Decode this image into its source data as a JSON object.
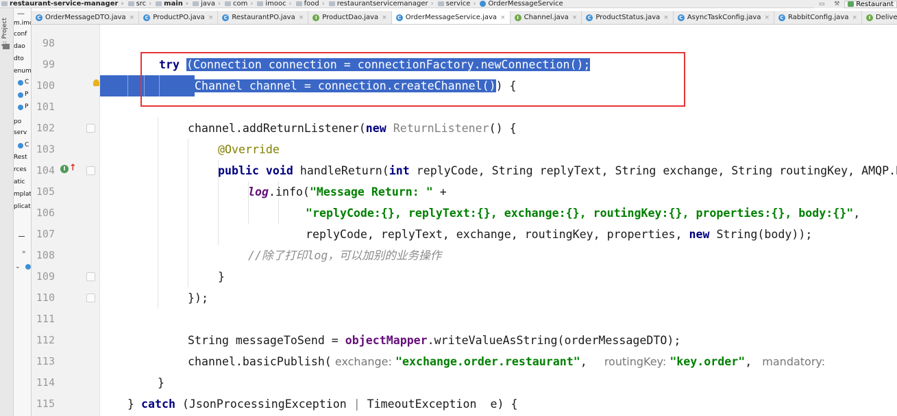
{
  "breadcrumb": [
    {
      "label": "restaurant-service-manager",
      "kind": "module"
    },
    {
      "label": "src",
      "kind": "folder"
    },
    {
      "label": "main",
      "kind": "folder-bold"
    },
    {
      "label": "java",
      "kind": "folder"
    },
    {
      "label": "com",
      "kind": "folder"
    },
    {
      "label": "imooc",
      "kind": "folder"
    },
    {
      "label": "food",
      "kind": "folder"
    },
    {
      "label": "restaurantservicemanager",
      "kind": "folder"
    },
    {
      "label": "service",
      "kind": "folder"
    },
    {
      "label": "OrderMessageService",
      "kind": "class"
    }
  ],
  "run_config": {
    "label": "Restaurant"
  },
  "tool_window": {
    "label": "1: Project"
  },
  "project_tree": [
    {
      "label": "m.imo",
      "icon": "none"
    },
    {
      "label": "conf",
      "icon": "folder"
    },
    {
      "label": "dao",
      "icon": "folder"
    },
    {
      "label": "dto",
      "icon": "folder"
    },
    {
      "label": "enum",
      "icon": "folder"
    },
    {
      "label": "C",
      "icon": "class"
    },
    {
      "label": "P",
      "icon": "class"
    },
    {
      "label": "P",
      "icon": "class"
    },
    {
      "label": "po",
      "icon": "folder"
    },
    {
      "label": "serv",
      "icon": "folder"
    },
    {
      "label": "C",
      "icon": "class"
    },
    {
      "label": "Rest",
      "icon": "none"
    },
    {
      "label": "rces",
      "icon": "none"
    },
    {
      "label": "atic",
      "icon": "none"
    },
    {
      "label": "mplat",
      "icon": "none"
    },
    {
      "label": "plicat",
      "icon": "none"
    }
  ],
  "tabs": [
    {
      "label": "OrderMessageDTO.java",
      "icon": "C",
      "active": false
    },
    {
      "label": "ProductPO.java",
      "icon": "C",
      "active": false
    },
    {
      "label": "RestaurantPO.java",
      "icon": "C",
      "active": false
    },
    {
      "label": "ProductDao.java",
      "icon": "I",
      "active": false
    },
    {
      "label": "OrderMessageService.java",
      "icon": "C",
      "active": true
    },
    {
      "label": "Channel.java",
      "icon": "I",
      "active": false
    },
    {
      "label": "ProductStatus.java",
      "icon": "C",
      "active": false
    },
    {
      "label": "AsyncTaskConfig.java",
      "icon": "C",
      "active": false
    },
    {
      "label": "RabbitConfig.java",
      "icon": "C",
      "active": false
    },
    {
      "label": "DeliverCallba",
      "icon": "I",
      "active": false
    }
  ],
  "lines": [
    {
      "num": "98",
      "indent": 0,
      "tokens": []
    },
    {
      "num": "99",
      "indent": 86,
      "tokens": [
        {
          "t": "try",
          "c": "kw"
        },
        {
          "t": " ",
          "c": "normal"
        },
        {
          "t": "(Connection connection = connectionFactory.newConnection();",
          "c": "sel"
        }
      ]
    },
    {
      "num": "100",
      "indent": 138,
      "selfill": true,
      "tokens": [
        {
          "t": "Channel channel = connection.createChannel()",
          "c": "sel"
        },
        {
          "t": ") {",
          "c": "normal"
        }
      ]
    },
    {
      "num": "101",
      "indent": 0,
      "tokens": []
    },
    {
      "num": "102",
      "indent": 128,
      "tokens": [
        {
          "t": "channel.addReturnListener(",
          "c": "normal"
        },
        {
          "t": "new",
          "c": "kw"
        },
        {
          "t": " ",
          "c": "normal"
        },
        {
          "t": "ReturnListener",
          "c": "gray"
        },
        {
          "t": "() {",
          "c": "normal"
        }
      ]
    },
    {
      "num": "103",
      "indent": 172,
      "tokens": [
        {
          "t": "@Override",
          "c": "ann"
        }
      ]
    },
    {
      "num": "104",
      "indent": 172,
      "tokens": [
        {
          "t": "public void",
          "c": "kw"
        },
        {
          "t": " handleReturn(",
          "c": "normal"
        },
        {
          "t": "int",
          "c": "kw"
        },
        {
          "t": " replyCode, String replyText, String exchange, String routingKey, AMQP.BasicProperties properties, ",
          "c": "normal"
        }
      ]
    },
    {
      "num": "105",
      "indent": 216,
      "tokens": [
        {
          "t": "log",
          "c": "static"
        },
        {
          "t": ".info(",
          "c": "normal"
        },
        {
          "t": "\"Message Return: \"",
          "c": "str"
        },
        {
          "t": " +",
          "c": "normal"
        }
      ]
    },
    {
      "num": "106",
      "indent": 300,
      "tokens": [
        {
          "t": "\"replyCode:{}, replyText:{}, exchange:{}, routingKey:{}, properties:{}, body:{}\"",
          "c": "str"
        },
        {
          "t": ",",
          "c": "normal"
        }
      ]
    },
    {
      "num": "107",
      "indent": 300,
      "tokens": [
        {
          "t": "replyCode, replyText, exchange, routingKey, properties, ",
          "c": "normal"
        },
        {
          "t": "new",
          "c": "kw"
        },
        {
          "t": " String(body));",
          "c": "normal"
        }
      ]
    },
    {
      "num": "108",
      "indent": 216,
      "tokens": [
        {
          "t": "//除了打印log，可以加别的业务操作",
          "c": "cmt"
        }
      ]
    },
    {
      "num": "109",
      "indent": 172,
      "tokens": [
        {
          "t": "}",
          "c": "normal"
        }
      ]
    },
    {
      "num": "110",
      "indent": 128,
      "tokens": [
        {
          "t": "});",
          "c": "normal"
        }
      ]
    },
    {
      "num": "111",
      "indent": 0,
      "tokens": []
    },
    {
      "num": "112",
      "indent": 128,
      "tokens": [
        {
          "t": "String messageToSend = ",
          "c": "normal"
        },
        {
          "t": "objectMapper",
          "c": "field"
        },
        {
          "t": ".writeValueAsString(orderMessageDTO);",
          "c": "normal"
        }
      ]
    },
    {
      "num": "113",
      "indent": 128,
      "tokens": [
        {
          "t": "channel.basicPublish(",
          "c": "normal"
        },
        {
          "t": " exchange: ",
          "c": "hint"
        },
        {
          "t": "\"exchange.order.restaurant\"",
          "c": "str"
        },
        {
          "t": ",  ",
          "c": "normal"
        },
        {
          "t": " routingKey: ",
          "c": "hint"
        },
        {
          "t": "\"key.order\"",
          "c": "str"
        },
        {
          "t": ", ",
          "c": "normal"
        },
        {
          "t": " mandatory: ",
          "c": "hint"
        }
      ]
    },
    {
      "num": "114",
      "indent": 84,
      "tokens": [
        {
          "t": "}",
          "c": "normal"
        }
      ]
    },
    {
      "num": "115",
      "indent": 40,
      "tokens": [
        {
          "t": "} ",
          "c": "normal"
        },
        {
          "t": "catch",
          "c": "kw"
        },
        {
          "t": " (JsonProcessingException ",
          "c": "normal"
        },
        {
          "t": "|",
          "c": "gray"
        },
        {
          "t": " TimeoutException  e) {",
          "c": "normal"
        }
      ]
    }
  ],
  "gutter_icons": {
    "line_104_impl": "I",
    "line_104_arrow": "↑"
  }
}
